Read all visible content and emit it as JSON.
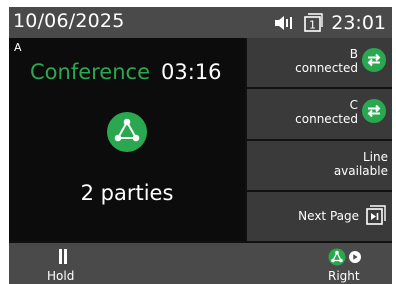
{
  "status": {
    "date": "10/06/2025",
    "time": "23:01",
    "line_number": "1"
  },
  "call": {
    "letter": "A",
    "state": "Conference",
    "duration": "03:16",
    "parties": "2 parties"
  },
  "side_buttons": [
    {
      "id": "B",
      "status": "connected"
    },
    {
      "id": "C",
      "status": "connected"
    },
    {
      "line1": "Line",
      "line2": "available"
    }
  ],
  "next_page": "Next Page",
  "softkeys": {
    "left": "Hold",
    "right": "Right"
  },
  "colors": {
    "accent": "#2aa84f",
    "bar": "#4a4a4a",
    "button": "#3a3a3a",
    "panel": "#0c0c0c"
  }
}
